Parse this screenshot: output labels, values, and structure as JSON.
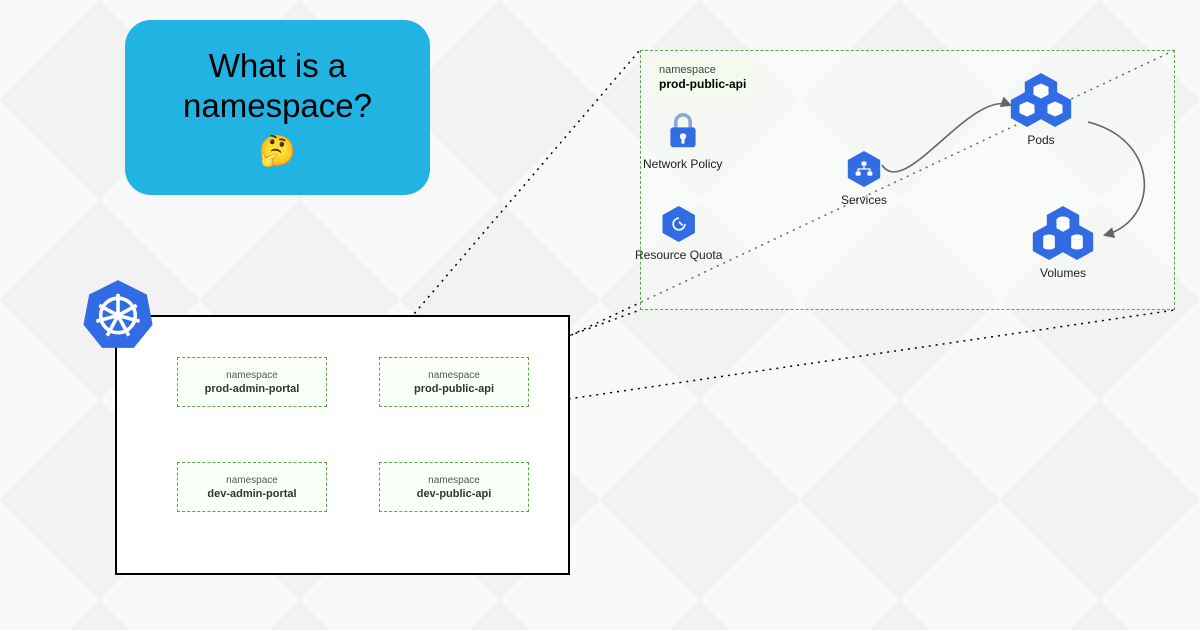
{
  "title_card": {
    "line1": "What is a",
    "line2": "namespace?",
    "emoji": "🤔"
  },
  "cluster": {
    "namespaces": [
      {
        "label": "namespace",
        "name": "prod-admin-portal"
      },
      {
        "label": "namespace",
        "name": "prod-public-api"
      },
      {
        "label": "namespace",
        "name": "dev-admin-portal"
      },
      {
        "label": "namespace",
        "name": "dev-public-api"
      }
    ]
  },
  "zoom": {
    "label": "namespace",
    "name": "prod-public-api",
    "resources": {
      "network_policy": "Network Policy",
      "resource_quota": "Resource Quota",
      "services": "Services",
      "pods": "Pods",
      "volumes": "Volumes"
    }
  },
  "colors": {
    "k8s_blue": "#326ce5",
    "card_blue": "#21b4e2",
    "ns_green": "#5aa64f"
  }
}
